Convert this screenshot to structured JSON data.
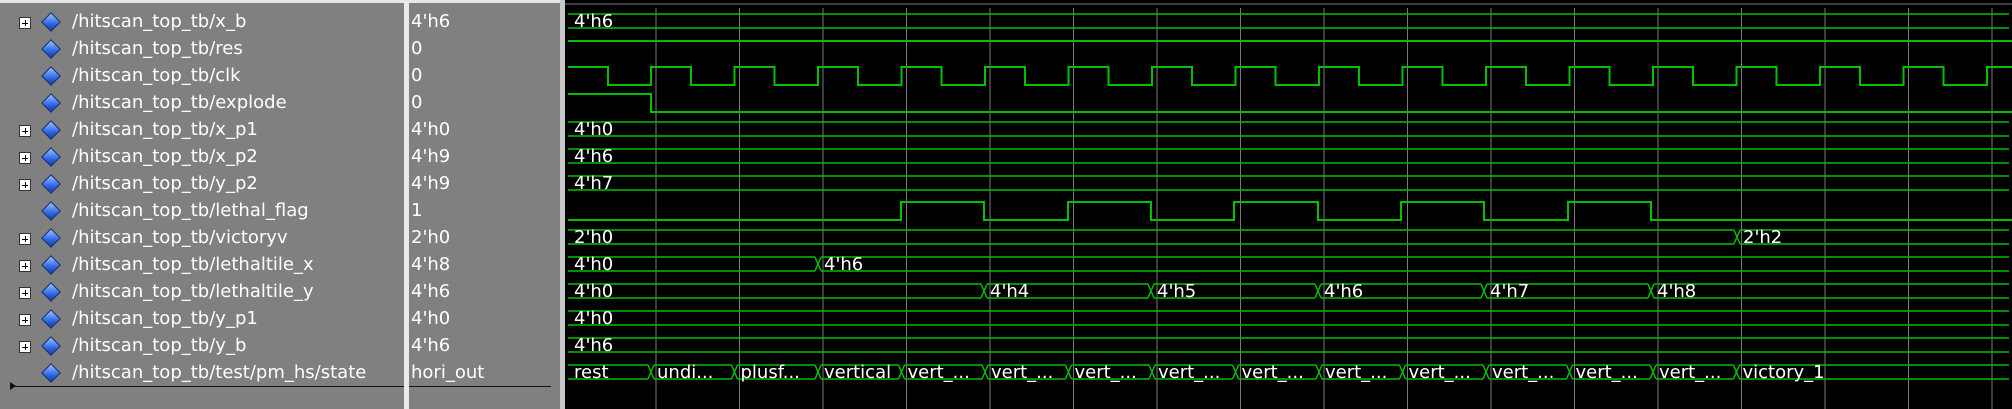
{
  "signals": [
    {
      "name": "/hitscan_top_tb/x_b",
      "value": "4'h6",
      "expandable": true
    },
    {
      "name": "/hitscan_top_tb/res",
      "value": "0",
      "expandable": false
    },
    {
      "name": "/hitscan_top_tb/clk",
      "value": "0",
      "expandable": false
    },
    {
      "name": "/hitscan_top_tb/explode",
      "value": "0",
      "expandable": false
    },
    {
      "name": "/hitscan_top_tb/x_p1",
      "value": "4'h0",
      "expandable": true
    },
    {
      "name": "/hitscan_top_tb/x_p2",
      "value": "4'h9",
      "expandable": true
    },
    {
      "name": "/hitscan_top_tb/y_p2",
      "value": "4'h9",
      "expandable": true
    },
    {
      "name": "/hitscan_top_tb/lethal_flag",
      "value": "1",
      "expandable": false
    },
    {
      "name": "/hitscan_top_tb/victoryv",
      "value": "2'h0",
      "expandable": true
    },
    {
      "name": "/hitscan_top_tb/lethaltile_x",
      "value": "4'h8",
      "expandable": true
    },
    {
      "name": "/hitscan_top_tb/lethaltile_y",
      "value": "4'h6",
      "expandable": true
    },
    {
      "name": "/hitscan_top_tb/y_p1",
      "value": "4'h0",
      "expandable": true
    },
    {
      "name": "/hitscan_top_tb/y_b",
      "value": "4'h6",
      "expandable": true
    },
    {
      "name": "/hitscan_top_tb/test/pm_hs/state",
      "value": "hori_out",
      "expandable": false
    }
  ],
  "wave_labels": {
    "x_b": [
      "4'h6"
    ],
    "x_p1": [
      "4'h0"
    ],
    "x_p2": [
      "4'h6"
    ],
    "y_p2": [
      "4'h7"
    ],
    "victoryv": [
      "2'h0",
      "2'h2"
    ],
    "lethaltile_x": [
      "4'h0",
      "4'h6"
    ],
    "lethaltile_y": [
      "4'h0",
      "4'h4",
      "4'h5",
      "4'h6",
      "4'h7",
      "4'h8"
    ],
    "y_p1": [
      "4'h0"
    ],
    "y_b": [
      "4'h6"
    ],
    "state": [
      "rest",
      "undi...",
      "plusf...",
      "vertical",
      "vert_...",
      "vert_...",
      "vert_...",
      "vert_...",
      "vert_...",
      "vert_...",
      "vert_...",
      "vert_...",
      "vert_...",
      "vert_...",
      "victory_1"
    ]
  },
  "colors": {
    "wave": "#00c000",
    "grid": "#7a7a7a",
    "background": "#000000",
    "panel": "#808080"
  },
  "icons": {
    "expand": "plus-box-icon",
    "signal": "blue-diamond-icon"
  }
}
